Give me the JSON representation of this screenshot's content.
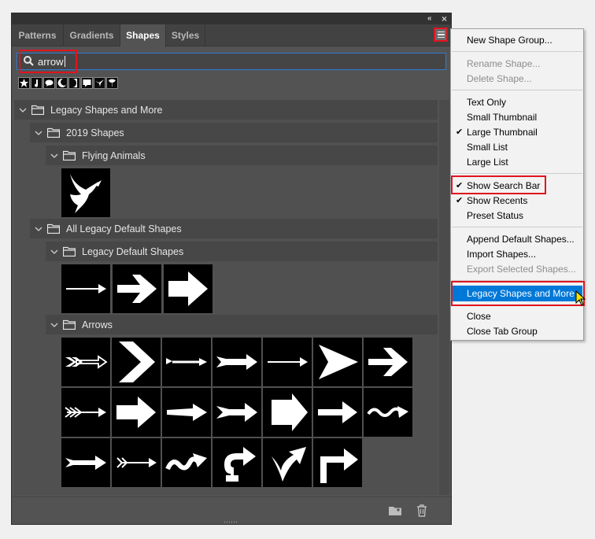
{
  "panel": {
    "collapse_glyph": "«",
    "close_glyph": "×",
    "tabs": [
      {
        "label": "Patterns",
        "active": false
      },
      {
        "label": "Gradients",
        "active": false
      },
      {
        "label": "Shapes",
        "active": true
      },
      {
        "label": "Styles",
        "active": false
      }
    ]
  },
  "search": {
    "query": "arrow",
    "icon": "search-icon"
  },
  "recents": [
    "tree-icon",
    "music-note-icon",
    "speech-bubble-icon",
    "moon-icon",
    "crescent-icon",
    "speech-bubble-icon",
    "bird-icon",
    "leaf-icon"
  ],
  "tree": {
    "root": "Legacy Shapes and More",
    "group_2019": "2019 Shapes",
    "flying_animals": "Flying Animals",
    "all_legacy": "All Legacy Default Shapes",
    "legacy_default": "Legacy Default Shapes",
    "arrows": "Arrows"
  },
  "footer": {
    "new_group_icon": "folder-icon",
    "delete_icon": "trash-icon"
  },
  "menu": {
    "items": [
      {
        "label": "New Shape Group...",
        "disabled": false,
        "checked": false
      },
      {
        "label": "Rename Shape...",
        "disabled": true,
        "checked": false
      },
      {
        "label": "Delete Shape...",
        "disabled": true,
        "checked": false
      },
      {
        "label": "Text Only",
        "disabled": false,
        "checked": false
      },
      {
        "label": "Small Thumbnail",
        "disabled": false,
        "checked": false
      },
      {
        "label": "Large Thumbnail",
        "disabled": false,
        "checked": true
      },
      {
        "label": "Small List",
        "disabled": false,
        "checked": false
      },
      {
        "label": "Large List",
        "disabled": false,
        "checked": false
      },
      {
        "label": "Show Search Bar",
        "disabled": false,
        "checked": true
      },
      {
        "label": "Show Recents",
        "disabled": false,
        "checked": true
      },
      {
        "label": "Preset Status",
        "disabled": false,
        "checked": false
      },
      {
        "label": "Append Default Shapes...",
        "disabled": false,
        "checked": false
      },
      {
        "label": "Import Shapes...",
        "disabled": false,
        "checked": false
      },
      {
        "label": "Export Selected Shapes...",
        "disabled": true,
        "checked": false
      },
      {
        "label": "Legacy Shapes and More",
        "disabled": false,
        "checked": false,
        "selected": true
      },
      {
        "label": "Close",
        "disabled": false,
        "checked": false
      },
      {
        "label": "Close Tab Group",
        "disabled": false,
        "checked": false
      }
    ],
    "check_glyph": "✔"
  },
  "colors": {
    "highlight": "#e0141e",
    "selection": "#0078d7",
    "panel_bg": "#535353"
  }
}
